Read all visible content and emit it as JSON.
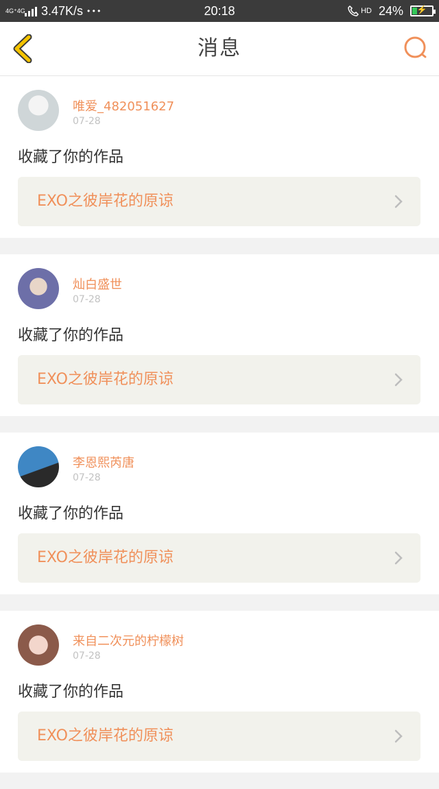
{
  "status_bar": {
    "network_label": "4G⁺4G",
    "speed": "3.47K/s",
    "dots": "• • •",
    "time": "20:18",
    "hd": "HD",
    "battery_percent": "24%",
    "battery_level": 0.24,
    "charging": true
  },
  "header": {
    "title": "消息",
    "back_icon": "chevron-left-icon",
    "search_icon": "search-icon",
    "accent_color": "#f0905a",
    "back_color": "#f5c400"
  },
  "messages": [
    {
      "username": "唯爱_482051627",
      "date": "07-28",
      "action": "收藏了你的作品",
      "work_title": "EXO之彼岸花的原谅",
      "avatar_colors": [
        "#cfd6d8",
        "#f4f4f4"
      ]
    },
    {
      "username": "灿白盛世",
      "date": "07-28",
      "action": "收藏了你的作品",
      "work_title": "EXO之彼岸花的原谅",
      "avatar_colors": [
        "#6d6fa8",
        "#e8d6c8"
      ]
    },
    {
      "username": "李恩熙芮唐",
      "date": "07-28",
      "action": "收藏了你的作品",
      "work_title": "EXO之彼岸花的原谅",
      "avatar_colors": [
        "#3f87c4",
        "#2a2a2a"
      ]
    },
    {
      "username": "来自二次元的柠檬树",
      "date": "07-28",
      "action": "收藏了你的作品",
      "work_title": "EXO之彼岸花的原谅",
      "avatar_colors": [
        "#f3d6cc",
        "#8b5a4a"
      ]
    }
  ]
}
